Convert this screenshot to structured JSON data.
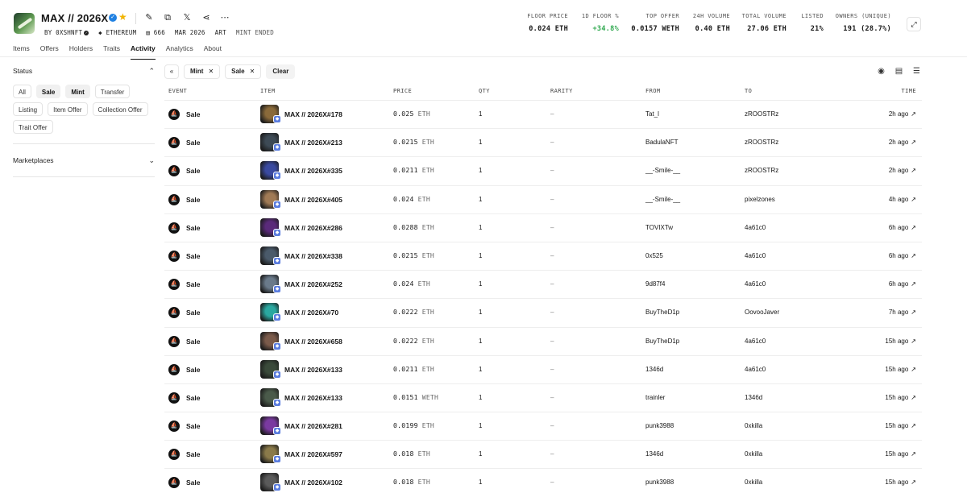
{
  "collection": {
    "name": "MAX // 2026X",
    "creator": "BY 0XSHNFT",
    "chain": "ETHEREUM",
    "supply": "666",
    "date": "MAR 2026",
    "category": "ART",
    "mint_status": "MINT ENDED"
  },
  "stats": [
    {
      "label": "FLOOR PRICE",
      "value": "0.024 ETH"
    },
    {
      "label": "1D FLOOR %",
      "value": "+34.8%"
    },
    {
      "label": "TOP OFFER",
      "value": "0.0157 WETH"
    },
    {
      "label": "24H VOLUME",
      "value": "0.40 ETH"
    },
    {
      "label": "TOTAL VOLUME",
      "value": "27.06 ETH"
    },
    {
      "label": "LISTED",
      "value": "21%"
    },
    {
      "label": "OWNERS (UNIQUE)",
      "value": "191 (28.7%)"
    }
  ],
  "colors": {
    "positive": "#2fa84f",
    "verified": "#2081e2",
    "star": "#f1b400",
    "chain_badge": "#5b7ddf"
  },
  "tabs": [
    "Items",
    "Offers",
    "Holders",
    "Traits",
    "Activity",
    "Analytics",
    "About"
  ],
  "active_tab": "Activity",
  "sidebar": {
    "status_title": "Status",
    "status_chips": [
      "All",
      "Sale",
      "Mint",
      "Transfer",
      "Listing",
      "Item Offer",
      "Collection Offer",
      "Trait Offer"
    ],
    "selected_chips": [
      "Sale",
      "Mint"
    ],
    "marketplaces_title": "Marketplaces"
  },
  "filters": {
    "active": [
      "Mint",
      "Sale"
    ],
    "clear_label": "Clear"
  },
  "table": {
    "headers": [
      "EVENT",
      "ITEM",
      "PRICE",
      "QTY",
      "RARITY",
      "FROM",
      "TO",
      "TIME"
    ],
    "rows": [
      {
        "event": "Sale",
        "item": "MAX // 2026X#178",
        "price": "0.025",
        "currency": "ETH",
        "qty": "1",
        "rarity": "–",
        "from": "Tat_l",
        "to": "zROOSTRz",
        "time": "2h ago"
      },
      {
        "event": "Sale",
        "item": "MAX // 2026X#213",
        "price": "0.0215",
        "currency": "ETH",
        "qty": "1",
        "rarity": "–",
        "from": "BadulaNFT",
        "to": "zROOSTRz",
        "time": "2h ago"
      },
      {
        "event": "Sale",
        "item": "MAX // 2026X#335",
        "price": "0.0211",
        "currency": "ETH",
        "qty": "1",
        "rarity": "–",
        "from": "__-Smile-__",
        "to": "zROOSTRz",
        "time": "2h ago"
      },
      {
        "event": "Sale",
        "item": "MAX // 2026X#405",
        "price": "0.024",
        "currency": "ETH",
        "qty": "1",
        "rarity": "–",
        "from": "__-Smile-__",
        "to": "pixelzones",
        "time": "4h ago"
      },
      {
        "event": "Sale",
        "item": "MAX // 2026X#286",
        "price": "0.0288",
        "currency": "ETH",
        "qty": "1",
        "rarity": "–",
        "from": "TOVIXTw",
        "to": "4a61c0",
        "time": "6h ago"
      },
      {
        "event": "Sale",
        "item": "MAX // 2026X#338",
        "price": "0.0215",
        "currency": "ETH",
        "qty": "1",
        "rarity": "–",
        "from": "0x525",
        "to": "4a61c0",
        "time": "6h ago"
      },
      {
        "event": "Sale",
        "item": "MAX // 2026X#252",
        "price": "0.024",
        "currency": "ETH",
        "qty": "1",
        "rarity": "–",
        "from": "9d87f4",
        "to": "4a61c0",
        "time": "6h ago"
      },
      {
        "event": "Sale",
        "item": "MAX // 2026X#70",
        "price": "0.0222",
        "currency": "ETH",
        "qty": "1",
        "rarity": "–",
        "from": "BuyTheD1p",
        "to": "OovooJaver",
        "time": "7h ago"
      },
      {
        "event": "Sale",
        "item": "MAX // 2026X#658",
        "price": "0.0222",
        "currency": "ETH",
        "qty": "1",
        "rarity": "–",
        "from": "BuyTheD1p",
        "to": "4a61c0",
        "time": "15h ago"
      },
      {
        "event": "Sale",
        "item": "MAX // 2026X#133",
        "price": "0.0211",
        "currency": "ETH",
        "qty": "1",
        "rarity": "–",
        "from": "1346d",
        "to": "4a61c0",
        "time": "15h ago"
      },
      {
        "event": "Sale",
        "item": "MAX // 2026X#133",
        "price": "0.0151",
        "currency": "WETH",
        "qty": "1",
        "rarity": "–",
        "from": "trainler",
        "to": "1346d",
        "time": "15h ago"
      },
      {
        "event": "Sale",
        "item": "MAX // 2026X#281",
        "price": "0.0199",
        "currency": "ETH",
        "qty": "1",
        "rarity": "–",
        "from": "punk3988",
        "to": "0xkilla",
        "time": "15h ago"
      },
      {
        "event": "Sale",
        "item": "MAX // 2026X#597",
        "price": "0.018",
        "currency": "ETH",
        "qty": "1",
        "rarity": "–",
        "from": "1346d",
        "to": "0xkilla",
        "time": "15h ago"
      },
      {
        "event": "Sale",
        "item": "MAX // 2026X#102",
        "price": "0.018",
        "currency": "ETH",
        "qty": "1",
        "rarity": "–",
        "from": "punk3988",
        "to": "0xkilla",
        "time": "15h ago"
      }
    ],
    "thumb_colors": [
      "#8a6a3a",
      "#3d4a55",
      "#3a4aa0",
      "#a07a55",
      "#5a2a7a",
      "#4a5a6a",
      "#6a7a8a",
      "#2aa8a0",
      "#7a5a4a",
      "#3a4a3a",
      "#4a5a4a",
      "#7a3aa0",
      "#8a7a4a",
      "#5a5a5a"
    ]
  }
}
